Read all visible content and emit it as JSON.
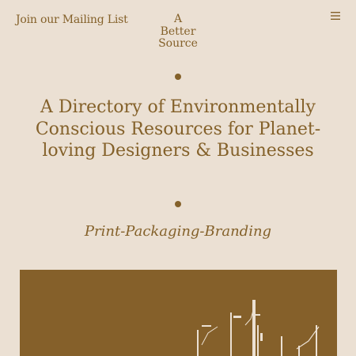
{
  "header": {
    "mailing_list_link": "Join our Mailing List",
    "logo_lines": [
      "A",
      "Better",
      "Source"
    ],
    "menu_icon": "hamburger-menu-icon"
  },
  "hero_text": {
    "headline": "A Directory of Environmentally Conscious Resources for Planet-loving Designers & Businesses",
    "tagline": "Print-Packaging-Branding"
  },
  "colors": {
    "background": "#ebe0d3",
    "accent": "#84612a"
  }
}
